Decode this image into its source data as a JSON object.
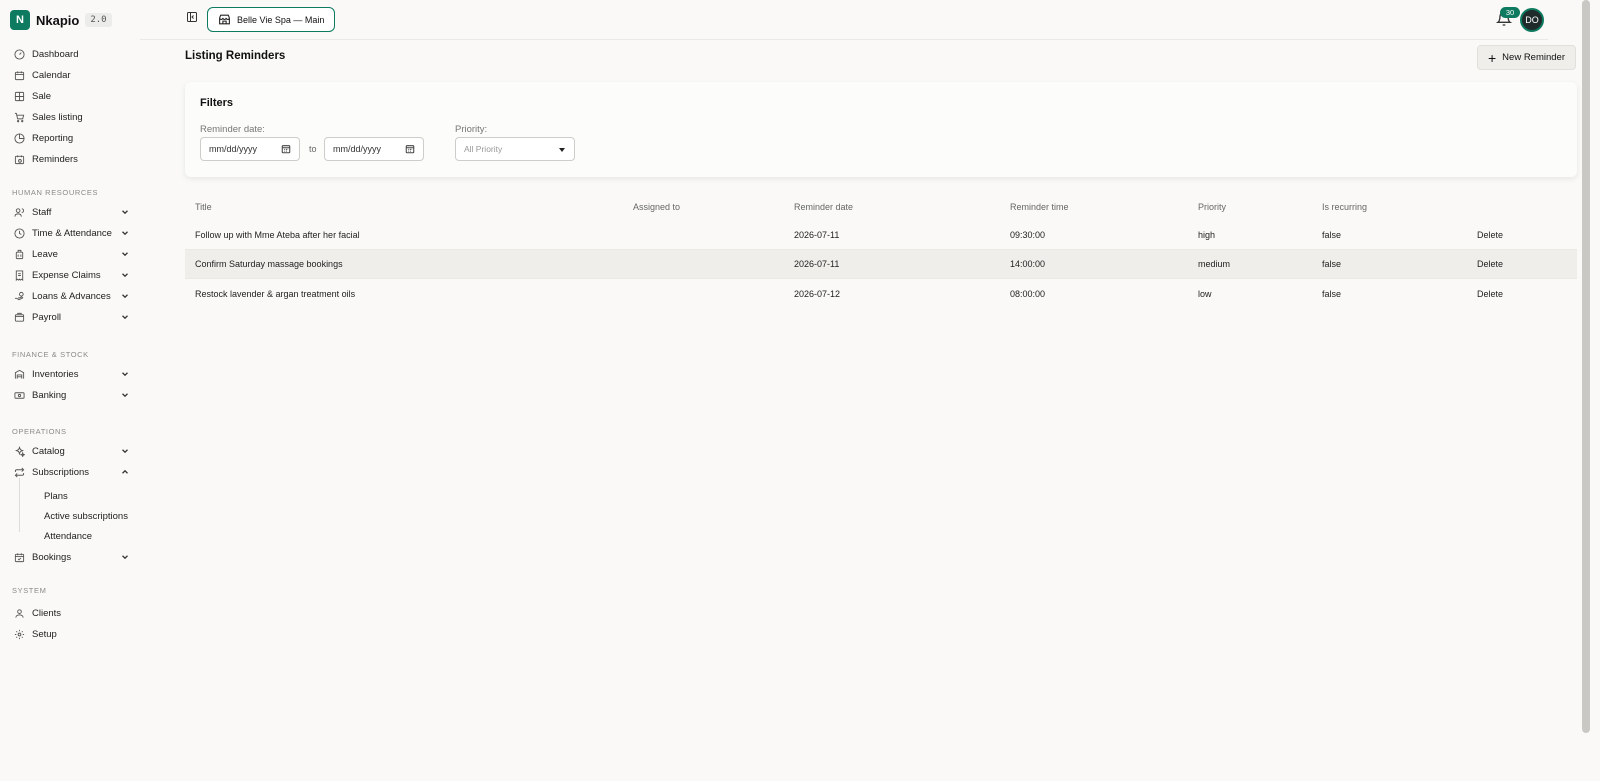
{
  "brand": {
    "logo_letter": "N",
    "name": "Nkapio",
    "version": "2.0"
  },
  "sidebar": {
    "main_items": [
      {
        "label": "Dashboard",
        "icon": "gauge-icon"
      },
      {
        "label": "Calendar",
        "icon": "calendar-icon"
      },
      {
        "label": "Sale",
        "icon": "grid-icon"
      },
      {
        "label": "Sales listing",
        "icon": "cart-icon"
      },
      {
        "label": "Reporting",
        "icon": "pie-chart-icon"
      },
      {
        "label": "Reminders",
        "icon": "calendar-clock-icon"
      }
    ],
    "sections": [
      {
        "label": "HUMAN RESOURCES",
        "items": [
          {
            "label": "Staff",
            "icon": "users-icon"
          },
          {
            "label": "Time & Attendance",
            "icon": "clock-icon"
          },
          {
            "label": "Leave",
            "icon": "luggage-icon"
          },
          {
            "label": "Expense Claims",
            "icon": "receipt-icon"
          },
          {
            "label": "Loans & Advances",
            "icon": "hand-coins-icon"
          },
          {
            "label": "Payroll",
            "icon": "wallet-icon"
          }
        ]
      },
      {
        "label": "FINANCE & STOCK",
        "items": [
          {
            "label": "Inventories",
            "icon": "warehouse-icon"
          },
          {
            "label": "Banking",
            "icon": "banknote-icon"
          }
        ]
      },
      {
        "label": "OPERATIONS",
        "items": [
          {
            "label": "Catalog",
            "icon": "sparkles-icon"
          },
          {
            "label": "Subscriptions",
            "icon": "repeat-icon"
          },
          {
            "label": "Bookings",
            "icon": "calendar-check-icon"
          }
        ]
      },
      {
        "label": "SYSTEM",
        "items": [
          {
            "label": "Clients",
            "icon": "user-icon"
          },
          {
            "label": "Setup",
            "icon": "gear-icon"
          }
        ]
      }
    ],
    "subscription_subitems": [
      "Plans",
      "Active subscriptions",
      "Attendance"
    ]
  },
  "header": {
    "shop_name": "Belle Vie Spa — Main",
    "notification_count": "30",
    "avatar_initials": "DO"
  },
  "page": {
    "title": "Listing Reminders",
    "new_button_label": "New Reminder"
  },
  "filters": {
    "title": "Filters",
    "date_label": "Reminder date:",
    "date_from_placeholder": "mm/dd/yyyy",
    "date_to_placeholder": "mm/dd/yyyy",
    "to_label": "to",
    "priority_label": "Priority:",
    "priority_selected": "All Priority"
  },
  "table": {
    "columns": [
      "Title",
      "Assigned to",
      "Reminder date",
      "Reminder time",
      "Priority",
      "Is recurring",
      ""
    ],
    "rows": [
      [
        "Follow up with Mme Ateba after her facial",
        "",
        "2026-07-11",
        "09:30:00",
        "high",
        "false",
        "Delete"
      ],
      [
        "Confirm Saturday massage bookings",
        "",
        "2026-07-11",
        "14:00:00",
        "medium",
        "false",
        "Delete"
      ],
      [
        "Restock lavender & argan treatment oils",
        "",
        "2026-07-12",
        "08:00:00",
        "low",
        "false",
        "Delete"
      ]
    ]
  },
  "colors": {
    "accent": "#0e7a5f",
    "background": "#faf9f7",
    "row_highlight": "#efeeeb"
  }
}
